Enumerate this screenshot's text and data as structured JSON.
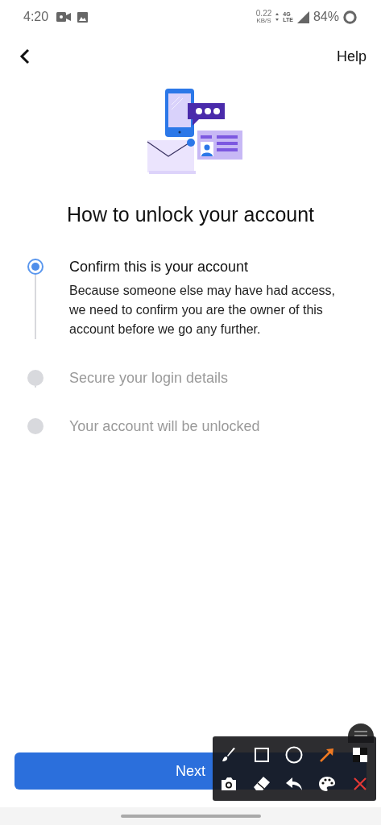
{
  "status_bar": {
    "time": "4:20",
    "data_speed": "0.22",
    "data_unit": "KB/S",
    "network_top": "4G",
    "network_bottom": "LTE",
    "battery": "84%"
  },
  "nav": {
    "help": "Help"
  },
  "title": "How to unlock your account",
  "steps": [
    {
      "title": "Confirm this is your account",
      "description": "Because someone else may have had access, we need to confirm you are the owner of this account before we go any further.",
      "selected": true
    },
    {
      "title": "Secure your login details",
      "selected": false
    },
    {
      "title": "Your account will be unlocked",
      "selected": false
    }
  ],
  "button": "Next",
  "toolbar": {
    "tools": [
      {
        "kind": "brush",
        "selected": false
      },
      {
        "kind": "rectangle",
        "selected": false
      },
      {
        "kind": "circle",
        "selected": false
      },
      {
        "kind": "arrow",
        "selected": true
      },
      {
        "kind": "mosaic",
        "selected": false
      },
      {
        "kind": "camera",
        "selected": false
      },
      {
        "kind": "eraser",
        "selected": false
      },
      {
        "kind": "undo",
        "selected": false
      },
      {
        "kind": "palette",
        "selected": false
      },
      {
        "kind": "close",
        "selected": false
      }
    ]
  }
}
